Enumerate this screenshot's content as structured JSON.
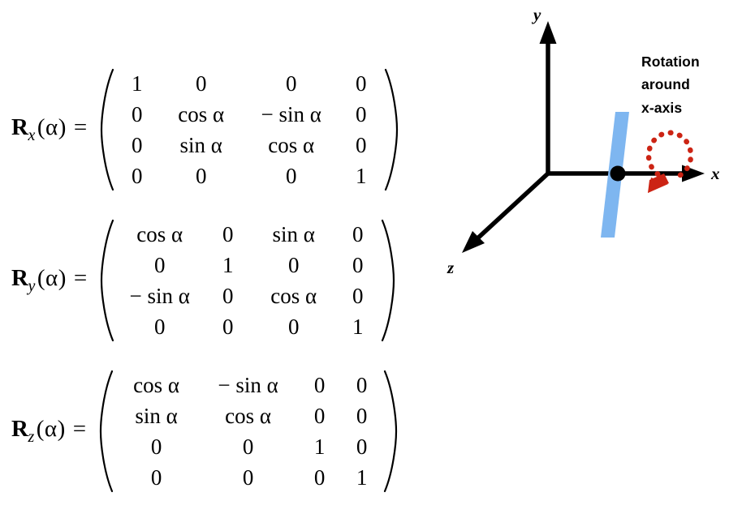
{
  "equations": [
    {
      "name": "rotation-matrix-x",
      "symbol": "R",
      "subscript": "x",
      "argument": "(α)",
      "equals": "=",
      "rows": [
        [
          "1",
          "0",
          "0",
          "0"
        ],
        [
          "0",
          "cos α",
          "− sin α",
          "0"
        ],
        [
          "0",
          "sin α",
          "cos α",
          "0"
        ],
        [
          "0",
          "0",
          "0",
          "1"
        ]
      ]
    },
    {
      "name": "rotation-matrix-y",
      "symbol": "R",
      "subscript": "y",
      "argument": "(α)",
      "equals": "=",
      "rows": [
        [
          "cos α",
          "0",
          "sin α",
          "0"
        ],
        [
          "0",
          "1",
          "0",
          "0"
        ],
        [
          "− sin α",
          "0",
          "cos α",
          "0"
        ],
        [
          "0",
          "0",
          "0",
          "1"
        ]
      ]
    },
    {
      "name": "rotation-matrix-z",
      "symbol": "R",
      "subscript": "z",
      "argument": "(α)",
      "equals": "=",
      "rows": [
        [
          "cos α",
          "− sin α",
          "0",
          "0"
        ],
        [
          "sin α",
          "cos α",
          "0",
          "0"
        ],
        [
          "0",
          "0",
          "1",
          "0"
        ],
        [
          "0",
          "0",
          "0",
          "1"
        ]
      ]
    }
  ],
  "diagram": {
    "axis_labels": {
      "x": "x",
      "y": "y",
      "z": "z"
    },
    "caption_lines": [
      "Rotation",
      "around",
      "x-axis"
    ],
    "colors": {
      "axis": "#000000",
      "plane": "#7EB6F0",
      "rotation_arrow": "#CC2414",
      "origin_dot": "#000000",
      "background": "#FFFFFF"
    }
  }
}
